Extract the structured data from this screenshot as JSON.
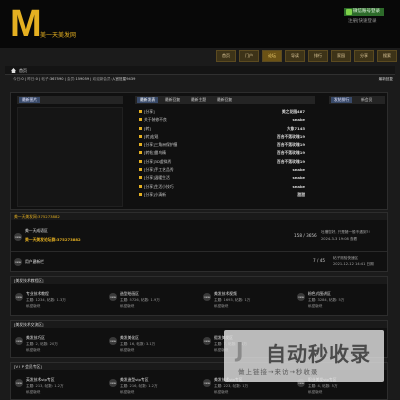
{
  "header": {
    "logo": "M",
    "site_name": "美一天美发网",
    "login": "微信账号登录",
    "register": "注册|快速登录"
  },
  "nav": [
    {
      "label": "首页",
      "active": false
    },
    {
      "label": "门户",
      "active": false
    },
    {
      "label": "论坛",
      "active": true
    },
    {
      "label": "导读",
      "active": false
    },
    {
      "label": "排行",
      "active": false
    },
    {
      "label": "家园",
      "active": false
    },
    {
      "label": "分享",
      "active": false
    },
    {
      "label": "搜索",
      "active": false
    }
  ],
  "breadcrumb": "首页",
  "stats": {
    "today_k": "今日:",
    "today_v": "0",
    "yest_k": "昨日:",
    "yest_v": "0",
    "posts_k": "帖子:",
    "posts_v": "367590",
    "members_k": "会员:",
    "members_v": "159059",
    "welcome": "欢迎新会员:",
    "new_member": "入宫狂星9439"
  },
  "recent": "最新回复",
  "panel": {
    "image_title": "最新图片",
    "tabs": [
      "最新发表",
      "最新回复",
      "最新主题",
      "最新回复"
    ],
    "new_title": "发帖排行",
    "new_tab2": "新会员",
    "threads": [
      {
        "title": "[分享]",
        "author": "美之花园487"
      },
      {
        "title": "关于装修不良",
        "author": "snake"
      },
      {
        "title": "[转]",
        "author": "大象7145"
      },
      {
        "title": "[转]宏观",
        "author": "百合不落玫瑰19"
      },
      {
        "title": "[分享]三角洲保护膜",
        "author": "百合不落玫瑰19"
      },
      {
        "title": "[转帖]雷鸟精",
        "author": "百合不落玫瑰19"
      },
      {
        "title": "[分享]3D虚拟秀",
        "author": "百合不落玫瑰19"
      },
      {
        "title": "[分享]手工艺品秀",
        "author": "snake"
      },
      {
        "title": "[分享]温暖生活",
        "author": "snake"
      },
      {
        "title": "[分享]生活小技巧",
        "author": "snake"
      },
      {
        "title": "[分享]小清新",
        "author": "甜甜"
      }
    ]
  },
  "sections": {
    "welcome": {
      "head": "美一天美发网:375273882",
      "forum": "美一天成语区",
      "forum_desc": "美一天美发论坛群:375273882",
      "count": "158 / 3656",
      "last_time": "2024-3-3 19:08 查看",
      "last_title": "吐槽您好, 只是猪一般不遇到?!"
    },
    "f2": {
      "forum": "用户建新栏",
      "count": "7 / 45",
      "last_title": "帖子测验快速区",
      "last_time": "2021-12-12 14:41 日期"
    },
    "board1": {
      "head": "[美发技术教程区]",
      "items": [
        {
          "forum": "专业技术教程",
          "stat": "主题: 1234, 帖数: 1.3万",
          "mod": "私密版块"
        },
        {
          "forum": "造型绘画区",
          "stat": "主题: 5726, 帖数: 1.9万",
          "mod": "私密版块"
        },
        {
          "forum": "美发技术视频",
          "stat": "主题: 1693, 帖数: 1万",
          "mod": "私密版块"
        },
        {
          "forum": "粉色式图讲区",
          "stat": "主题: 3284, 帖数: 5万",
          "mod": "私密版块"
        }
      ]
    },
    "board2": {
      "head": "[美发技术交流区]",
      "items": [
        {
          "forum": "美发技巧区",
          "stat": "主题: 2, 帖数: 20万",
          "mod": "私密版块"
        },
        {
          "forum": "美发美化区",
          "stat": "主题: 16, 帖数: 3.1万",
          "mod": "私密版块"
        },
        {
          "forum": "假发美发区",
          "stat": "主题: 7, 帖数: 1.1万",
          "mod": "私密版块"
        }
      ]
    },
    "board3": {
      "head": "[V I P 会员专区]",
      "items": [
        {
          "forum": "英发技术vip专区",
          "stat": "主题: 213, 帖数: 1.2万",
          "mod": "私密版块"
        },
        {
          "forum": "美发造型vip专区",
          "stat": "主题: 216, 帖数: 1.2万",
          "mod": "私密版块"
        },
        {
          "forum": "美发技术vip专区",
          "stat": "主题: 223, 帖数: 1万",
          "mod": "私密版块"
        },
        {
          "forum": "职业美发vip专区",
          "stat": "主题: 4, 帖数: 5万",
          "mod": "私密版块"
        }
      ]
    }
  },
  "watermark": {
    "main": "自动秒收录",
    "sub": "做上链接→来访→秒收录"
  },
  "colors": {
    "gold": "#e5b021",
    "nav_active": "#6b5215",
    "tab_blue": "#394a69",
    "login_green": "#2d6b2a"
  }
}
